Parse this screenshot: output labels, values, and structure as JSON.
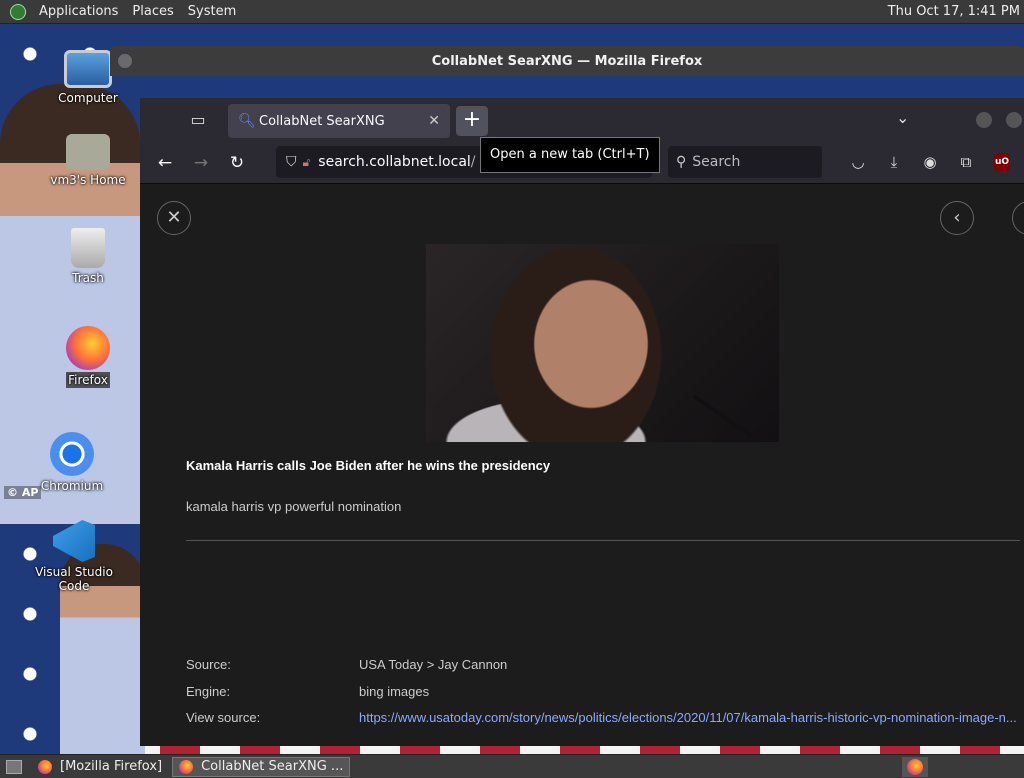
{
  "top_panel": {
    "menus": [
      "Applications",
      "Places",
      "System"
    ],
    "clock": "Thu Oct 17,  1:41 PM"
  },
  "desktop": {
    "icons": [
      {
        "label": "Computer"
      },
      {
        "label": "vm3's Home"
      },
      {
        "label": "Trash"
      },
      {
        "label": "Firefox"
      },
      {
        "label": "Chromium"
      },
      {
        "label": "Visual Studio Code"
      }
    ],
    "wallpaper_credit": "© AP"
  },
  "window": {
    "title": "CollabNet SearXNG — Mozilla Firefox"
  },
  "browser": {
    "tab_title": "CollabNet SearXNG",
    "url_host": "search.collabnet.local",
    "url_rest": "/",
    "search_placeholder": "Search",
    "tooltip": "Open a new tab (Ctrl+T)"
  },
  "result": {
    "title": "Kamala Harris calls Joe Biden after he wins the presidency",
    "description": "kamala harris vp powerful nomination",
    "source_label": "Source:",
    "source_value": "USA Today > Jay Cannon",
    "engine_label": "Engine:",
    "engine_value": "bing images",
    "view_source_label": "View source:",
    "view_source_value": "https://www.usatoday.com/story/news/politics/elections/2020/11/07/kamala-harris-historic-vp-nomination-image-n..."
  },
  "taskbar": {
    "items": [
      "[Mozilla Firefox]",
      "CollabNet SearXNG ..."
    ]
  },
  "colors": {
    "panel": "#3a3a3a",
    "browser_chrome": "#2b2a33",
    "page_bg": "#1c1c1c",
    "link": "#8aa9ff"
  }
}
